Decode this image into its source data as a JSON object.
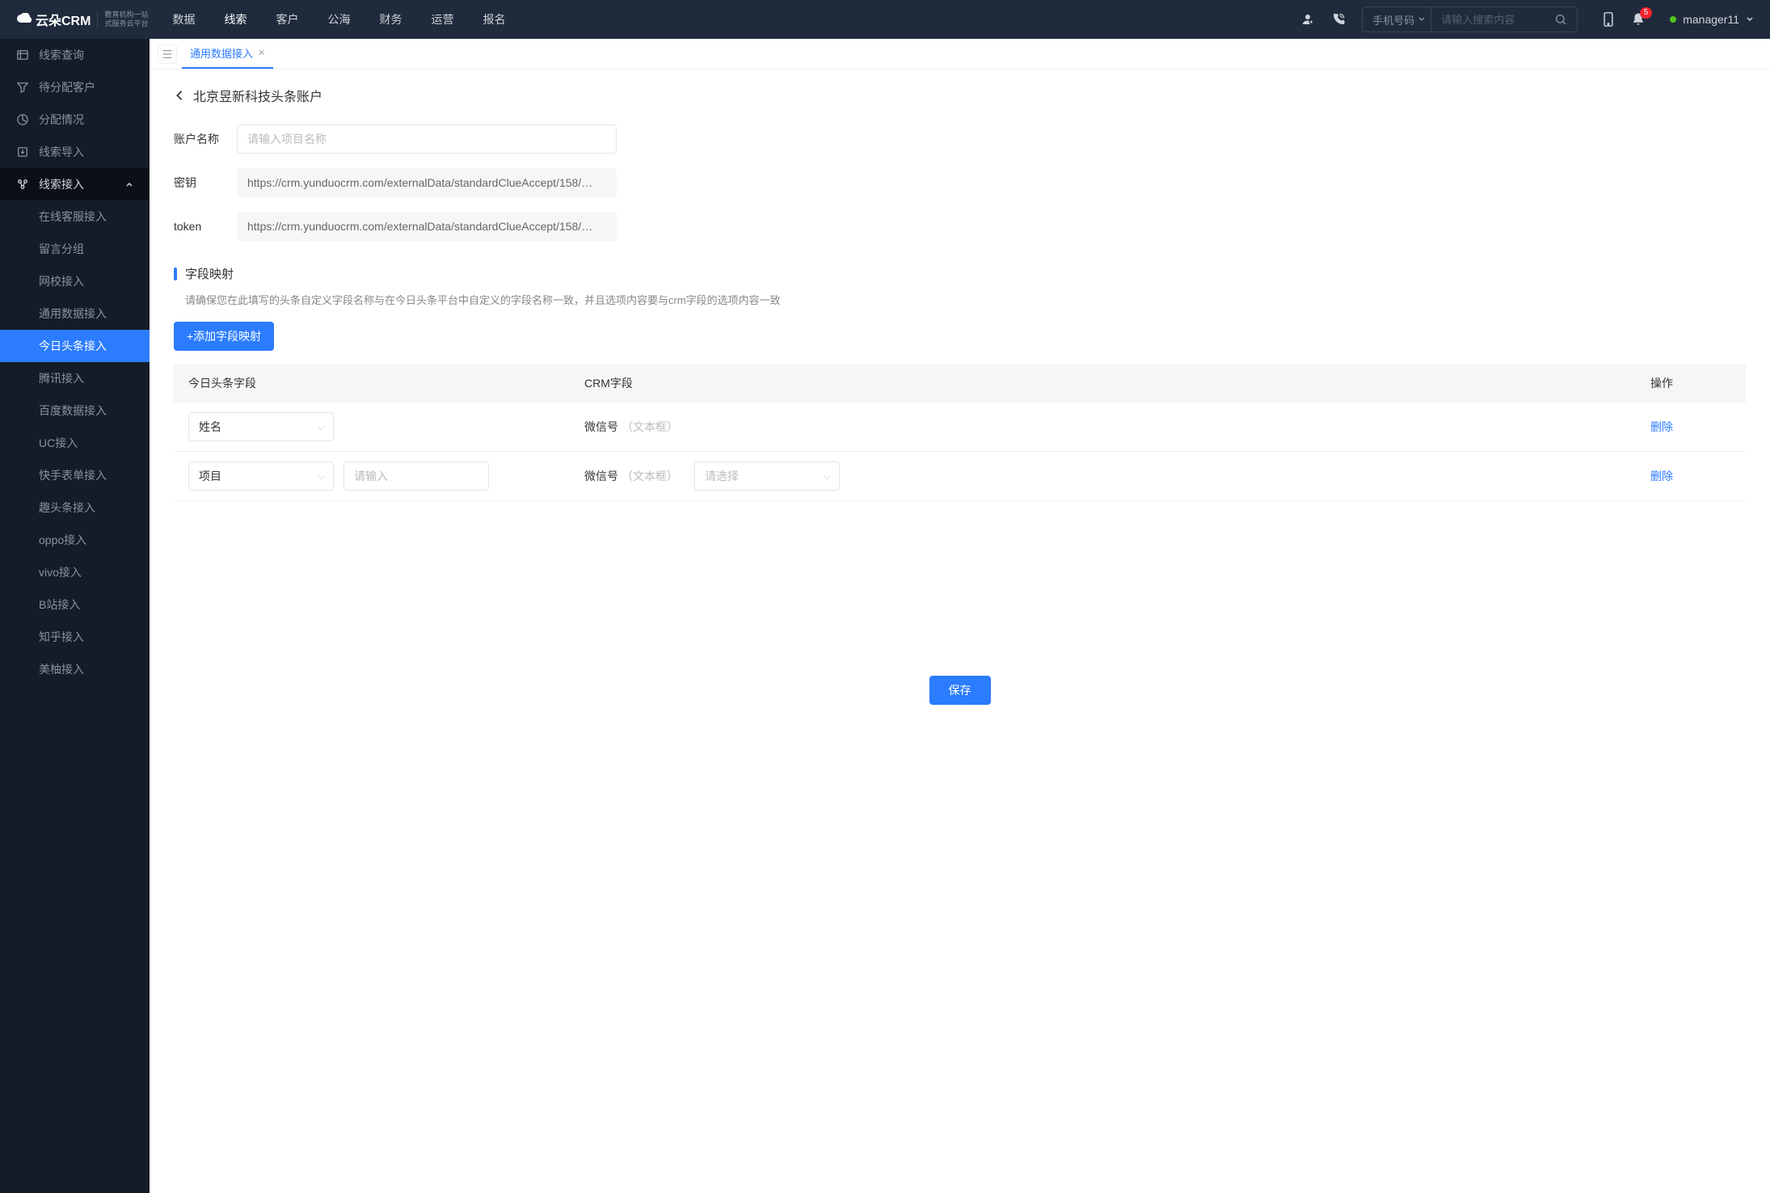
{
  "header": {
    "logo": "云朵CRM",
    "logo_sub1": "教育机构一站",
    "logo_sub2": "式服务云平台",
    "nav": [
      "数据",
      "线索",
      "客户",
      "公海",
      "财务",
      "运营",
      "报名"
    ],
    "active_nav_index": 1,
    "search_type": "手机号码",
    "search_placeholder": "请输入搜索内容",
    "notification_count": "5",
    "username": "manager11"
  },
  "sidebar": {
    "items": [
      {
        "label": "线索查询"
      },
      {
        "label": "待分配客户"
      },
      {
        "label": "分配情况"
      },
      {
        "label": "线索导入"
      }
    ],
    "expand": {
      "label": "线索接入"
    },
    "subitems": [
      {
        "label": "在线客服接入"
      },
      {
        "label": "留言分组"
      },
      {
        "label": "网校接入"
      },
      {
        "label": "通用数据接入"
      },
      {
        "label": "今日头条接入"
      },
      {
        "label": "腾讯接入"
      },
      {
        "label": "百度数据接入"
      },
      {
        "label": "UC接入"
      },
      {
        "label": "快手表单接入"
      },
      {
        "label": "趣头条接入"
      },
      {
        "label": "oppo接入"
      },
      {
        "label": "vivo接入"
      },
      {
        "label": "B站接入"
      },
      {
        "label": "知乎接入"
      },
      {
        "label": "美柚接入"
      }
    ],
    "active_sub_index": 4
  },
  "tabs": {
    "items": [
      {
        "label": "通用数据接入"
      }
    ],
    "active_index": 0
  },
  "page": {
    "title": "北京昱新科技头条账户",
    "form": {
      "account_label": "账户名称",
      "account_placeholder": "请输入项目名称",
      "secret_label": "密钥",
      "secret_value": "https://crm.yunduocrm.com/externalData/standardClueAccept/158/…",
      "token_label": "token",
      "token_value": "https://crm.yunduocrm.com/externalData/standardClueAccept/158/…"
    },
    "mapping": {
      "title": "字段映射",
      "desc": "请确保您在此填写的头条自定义字段名称与在今日头条平台中自定义的字段名称一致，并且选项内容要与crm字段的选项内容一致",
      "add_btn": "+添加字段映射",
      "columns": {
        "c1": "今日头条字段",
        "c2": "CRM字段",
        "c3": "操作"
      },
      "rows": [
        {
          "field": "姓名",
          "crm_label": "微信号",
          "crm_hint": "（文本框）",
          "delete": "删除",
          "has_text_input": false,
          "has_crm_select": false
        },
        {
          "field": "项目",
          "text_placeholder": "请输入",
          "crm_label": "微信号",
          "crm_hint": "（文本框）",
          "crm_select_placeholder": "请选择",
          "delete": "删除",
          "has_text_input": true,
          "has_crm_select": true
        }
      ]
    },
    "save_btn": "保存"
  }
}
